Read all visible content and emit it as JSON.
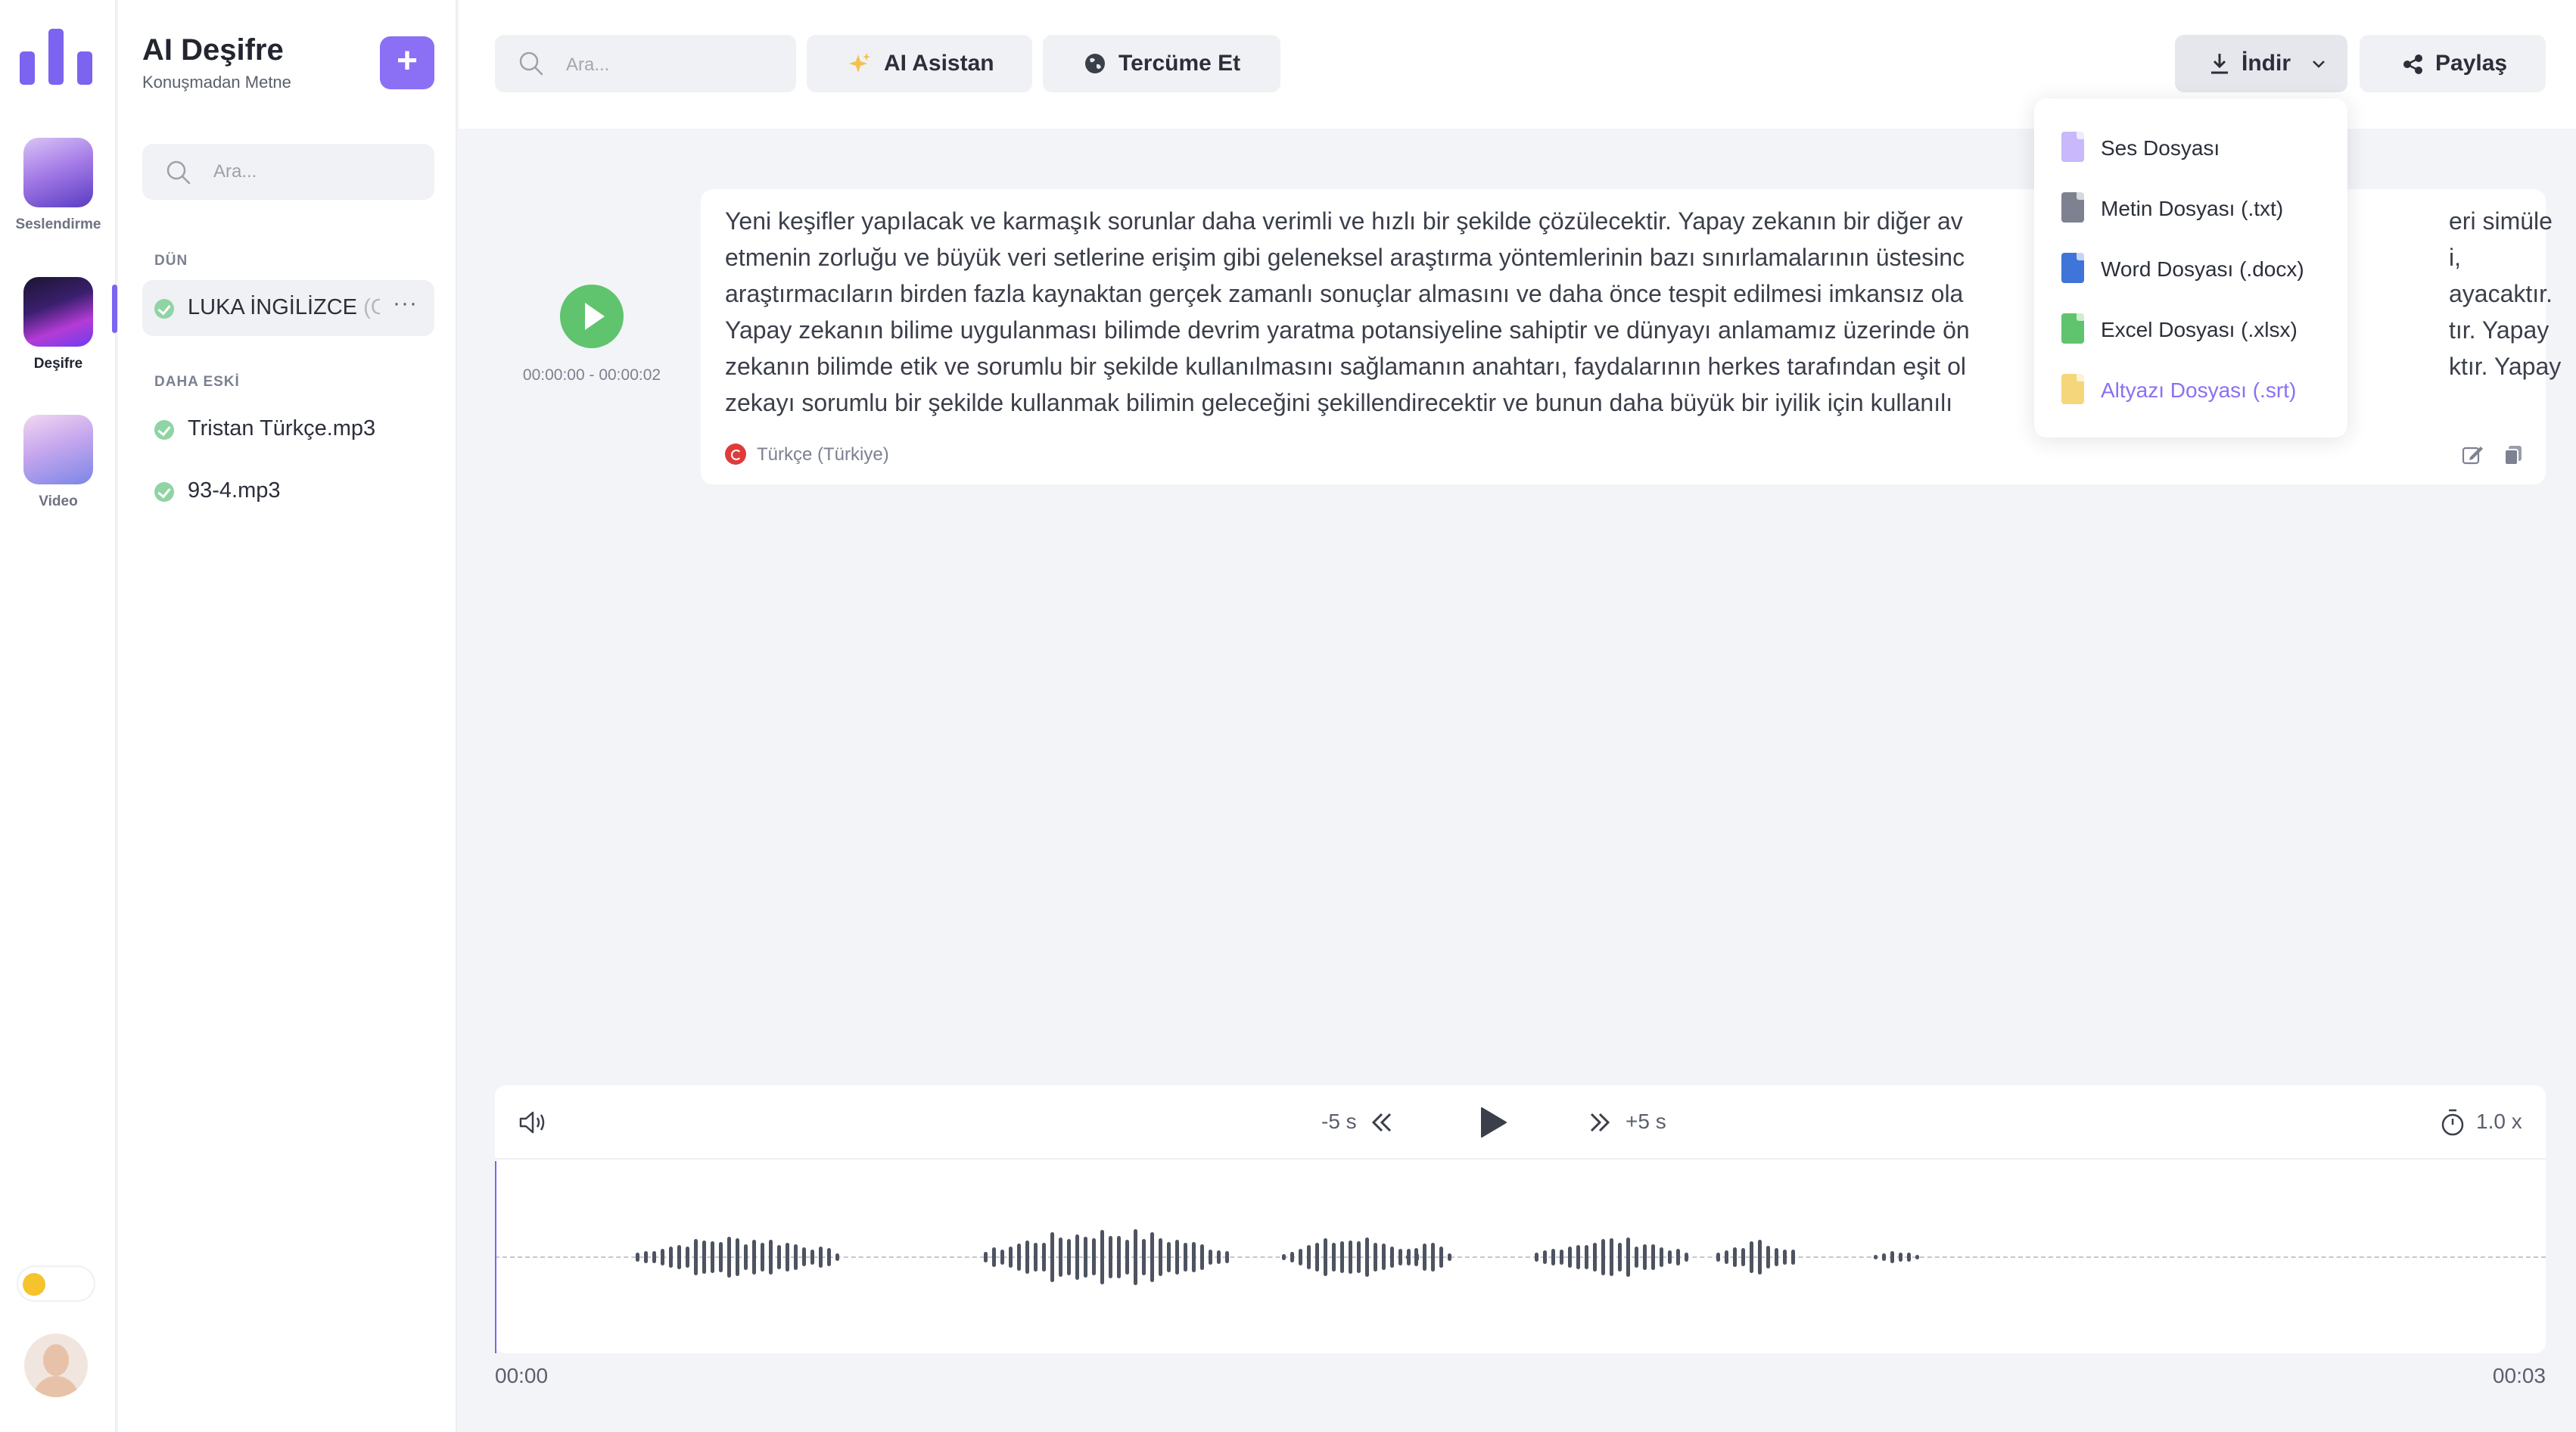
{
  "rail": {
    "items": [
      {
        "label": "Seslendirme"
      },
      {
        "label": "Deşifre"
      },
      {
        "label": "Video"
      }
    ]
  },
  "panel": {
    "title": "AI Deşifre",
    "subtitle": "Konuşmadan Metne",
    "add_label": "+",
    "search_placeholder": "Ara...",
    "section_recent": "DÜN",
    "section_older": "DAHA ESKİ",
    "recent_files": [
      {
        "name": "LUKA İNGİLİZCE",
        "name_suffix": " (G",
        "more": "···"
      }
    ],
    "older_files": [
      {
        "name": "Tristan Türkçe.mp3"
      },
      {
        "name": "93-4.mp3"
      }
    ]
  },
  "topbar": {
    "search_placeholder": "Ara...",
    "ai_button": "AI Asistan",
    "translate_button": "Tercüme Et",
    "download_button": "İndir",
    "share_button": "Paylaş"
  },
  "download_menu": {
    "items": [
      {
        "label": "Ses Dosyası",
        "icon": "audio-file-icon",
        "color": "#c9b8fb"
      },
      {
        "label": "Metin Dosyası (.txt)",
        "icon": "text-file-icon",
        "color": "#7d8190"
      },
      {
        "label": "Word Dosyası (.docx)",
        "icon": "word-file-icon",
        "color": "#3f74d8"
      },
      {
        "label": "Excel Dosyası (.xlsx)",
        "icon": "excel-file-icon",
        "color": "#5fc46d"
      },
      {
        "label": "Altyazı Dosyası (.srt)",
        "icon": "subtitle-file-icon",
        "color": "#f5d67a"
      }
    ]
  },
  "transcript": {
    "timecode": "00:00:00 - 00:00:02",
    "text_lines": [
      "Yeni keşifler yapılacak ve karmaşık sorunlar daha verimli ve hızlı bir şekilde çözülecektir. Yapay zekanın bir diğer av",
      "etmenin zorluğu ve büyük veri setlerine erişim gibi geleneksel araştırma yöntemlerinin bazı sınırlamalarının üstesinc",
      "araştırmacıların birden fazla kaynaktan gerçek zamanlı sonuçlar almasını ve daha önce tespit edilmesi imkansız ola",
      "Yapay zekanın bilime uygulanması bilimde devrim yaratma potansiyeline sahiptir ve dünyayı anlamamız üzerinde ön",
      "zekanın bilimde etik ve sorumlu bir şekilde kullanılmasını sağlamanın anahtarı, faydalarının herkes tarafından eşit ol",
      "zekayı sorumlu bir şekilde kullanmak bilimin geleceğini şekillendirecektir ve bunun daha büyük bir iyilik için kullanılı"
    ],
    "text_tails": [
      "eri simüle",
      "i,",
      "ayacaktır.",
      "tır. Yapay",
      "ktır. Yapay",
      ""
    ],
    "language": "Türkçe (Türkiye)"
  },
  "player": {
    "back_label": "-5 s",
    "forward_label": "+5 s",
    "speed": "1.0 x",
    "time_start": "00:00",
    "time_end": "00:03",
    "playhead_position": 0
  },
  "colors": {
    "accent": "#8b6ff5",
    "play_green": "#5fc46d",
    "waveform": "#4e5361"
  }
}
